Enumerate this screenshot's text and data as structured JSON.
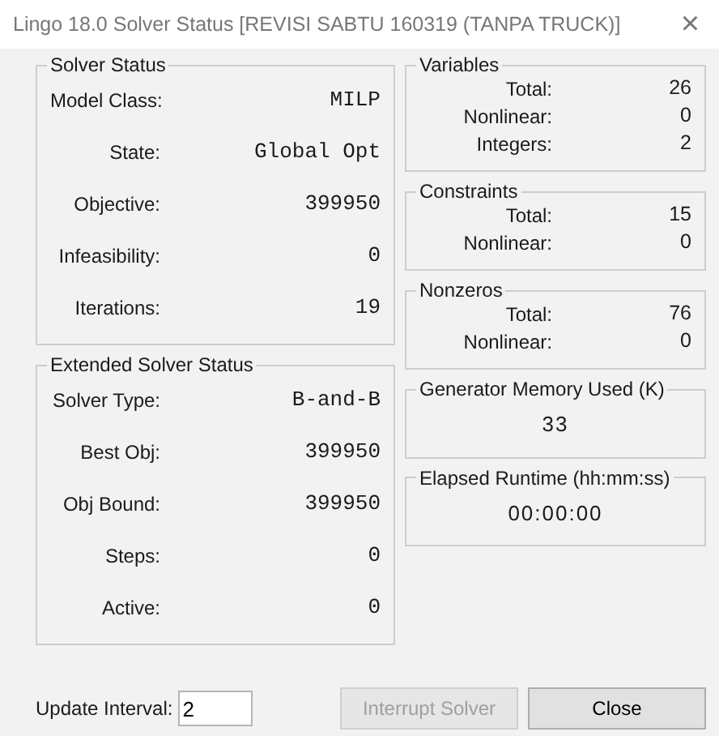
{
  "window": {
    "title": "Lingo 18.0 Solver Status [REVISI SABTU 160319 (TANPA TRUCK)]",
    "close": "×"
  },
  "left_groups": [
    {
      "title": "Solver Status",
      "rows": [
        {
          "label": "Model Class:",
          "value": "MILP"
        },
        {
          "label": "State:",
          "value": "Global Opt"
        },
        {
          "label": "Objective:",
          "value": "399950"
        },
        {
          "label": "Infeasibility:",
          "value": "0"
        },
        {
          "label": "Iterations:",
          "value": "19"
        }
      ]
    },
    {
      "title": "Extended Solver Status",
      "rows": [
        {
          "label": "Solver Type:",
          "value": "B-and-B"
        },
        {
          "label": "Best Obj:",
          "value": "399950"
        },
        {
          "label": "Obj Bound:",
          "value": "399950"
        },
        {
          "label": "Steps:",
          "value": "0"
        },
        {
          "label": "Active:",
          "value": "0"
        }
      ]
    }
  ],
  "right_groups": [
    {
      "title": "Variables",
      "rows": [
        {
          "label": "Total:",
          "value": "26"
        },
        {
          "label": "Nonlinear:",
          "value": "0"
        },
        {
          "label": "Integers:",
          "value": "2"
        }
      ]
    },
    {
      "title": "Constraints",
      "rows": [
        {
          "label": "Total:",
          "value": "15"
        },
        {
          "label": "Nonlinear:",
          "value": "0"
        }
      ]
    },
    {
      "title": "Nonzeros",
      "rows": [
        {
          "label": "Total:",
          "value": "76"
        },
        {
          "label": "Nonlinear:",
          "value": "0"
        }
      ]
    },
    {
      "title": "Generator Memory Used (K)",
      "value": "33"
    },
    {
      "title": "Elapsed Runtime (hh:mm:ss)",
      "value": "00:00:00"
    }
  ],
  "update_interval": {
    "label": "Update Interval:",
    "value": "2"
  },
  "buttons": [
    {
      "label": "Interrupt Solver",
      "disabled": true
    },
    {
      "label": "Close",
      "disabled": false
    }
  ]
}
